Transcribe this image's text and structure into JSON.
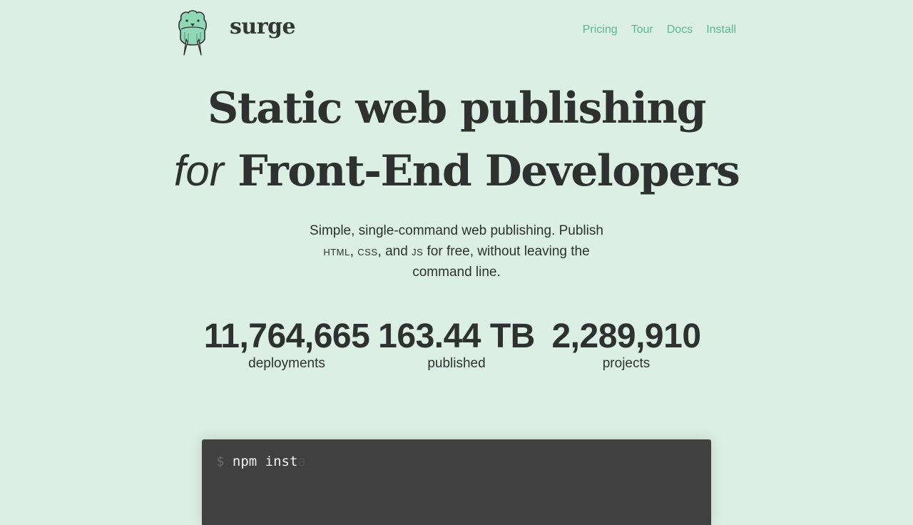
{
  "header": {
    "brand": "surge",
    "logo_icon": "walrus-logo-icon",
    "nav": [
      {
        "label": "Pricing"
      },
      {
        "label": "Tour"
      },
      {
        "label": "Docs"
      },
      {
        "label": "Install"
      }
    ]
  },
  "hero": {
    "title_line1": "Static web publishing",
    "title_em": "for",
    "title_line2": "Front-End Developers",
    "lede_part1": "Simple, single-command web publishing. Publish",
    "lede_html": "HTML",
    "lede_sep1": ", ",
    "lede_css": "CSS",
    "lede_sep2": ", and ",
    "lede_js": "JS",
    "lede_part2": " for free, without leaving the command line."
  },
  "stats": [
    {
      "value": "11,764,665",
      "label": "deployments"
    },
    {
      "value": "163.44 TB",
      "label": "published"
    },
    {
      "value": "2,289,910",
      "label": "projects"
    }
  ],
  "terminal": {
    "prompt": "$",
    "typed": "npm inst",
    "ghost": "a"
  },
  "colors": {
    "background": "#dcefe5",
    "accent": "#5ab892",
    "text": "#2d312f",
    "terminal_bg": "#404040"
  }
}
